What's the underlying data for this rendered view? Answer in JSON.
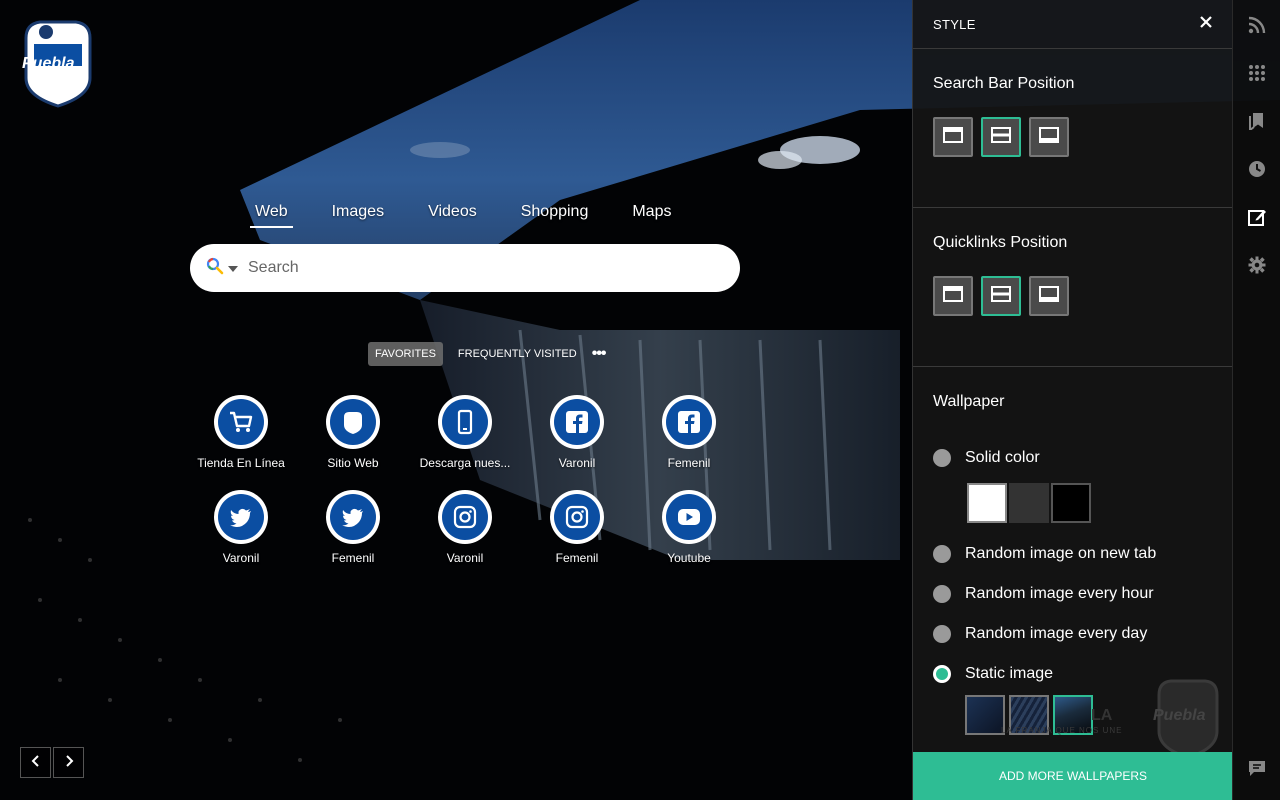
{
  "search": {
    "tabs": [
      "Web",
      "Images",
      "Videos",
      "Shopping",
      "Maps"
    ],
    "active_tab": "Web",
    "placeholder": "Search"
  },
  "quicklinks": {
    "tabs": [
      "FAVORITES",
      "FREQUENTLY VISITED"
    ],
    "active_tab": "FAVORITES",
    "more": "•••",
    "items": [
      {
        "label": "Tienda En Línea",
        "icon": "cart-icon"
      },
      {
        "label": "Sitio Web",
        "icon": "puebla-crest-icon"
      },
      {
        "label": "Descarga nues...",
        "icon": "phone-icon"
      },
      {
        "label": "Varonil",
        "icon": "facebook-icon"
      },
      {
        "label": "Femenil",
        "icon": "facebook-icon"
      },
      {
        "label": "Varonil",
        "icon": "twitter-icon"
      },
      {
        "label": "Femenil",
        "icon": "twitter-icon"
      },
      {
        "label": "Varonil",
        "icon": "instagram-icon"
      },
      {
        "label": "Femenil",
        "icon": "instagram-icon"
      },
      {
        "label": "Youtube",
        "icon": "youtube-icon"
      }
    ]
  },
  "panel": {
    "title": "STYLE",
    "search_bar_position": {
      "title": "Search Bar Position",
      "options": [
        "top",
        "middle",
        "bottom"
      ],
      "selected": "middle"
    },
    "quicklinks_position": {
      "title": "Quicklinks Position",
      "options": [
        "top",
        "middle",
        "bottom"
      ],
      "selected": "middle"
    },
    "wallpaper": {
      "title": "Wallpaper",
      "options": [
        {
          "label": "Solid color",
          "checked": false
        },
        {
          "label": "Random image on new tab",
          "checked": false
        },
        {
          "label": "Random image every hour",
          "checked": false
        },
        {
          "label": "Random image every day",
          "checked": false
        },
        {
          "label": "Static image",
          "checked": true
        }
      ],
      "swatches": [
        "#ffffff",
        "#333333",
        "#000000"
      ],
      "thumbnails_selected_index": 2,
      "watermark_text": "LA FRANJA QUE NOS UNE",
      "watermark_short": "LA",
      "watermark_logo": "Puebla"
    },
    "add_button": "ADD MORE WALLPAPERS"
  },
  "logo_text": "Puebla",
  "colors": {
    "accent": "#2ebd94",
    "brand_blue": "#0b4ea2"
  },
  "rail_icons": [
    "rss-icon",
    "apps-grid-icon",
    "bookmarks-icon",
    "history-icon",
    "edit-style-icon",
    "settings-icon",
    "feedback-icon"
  ]
}
